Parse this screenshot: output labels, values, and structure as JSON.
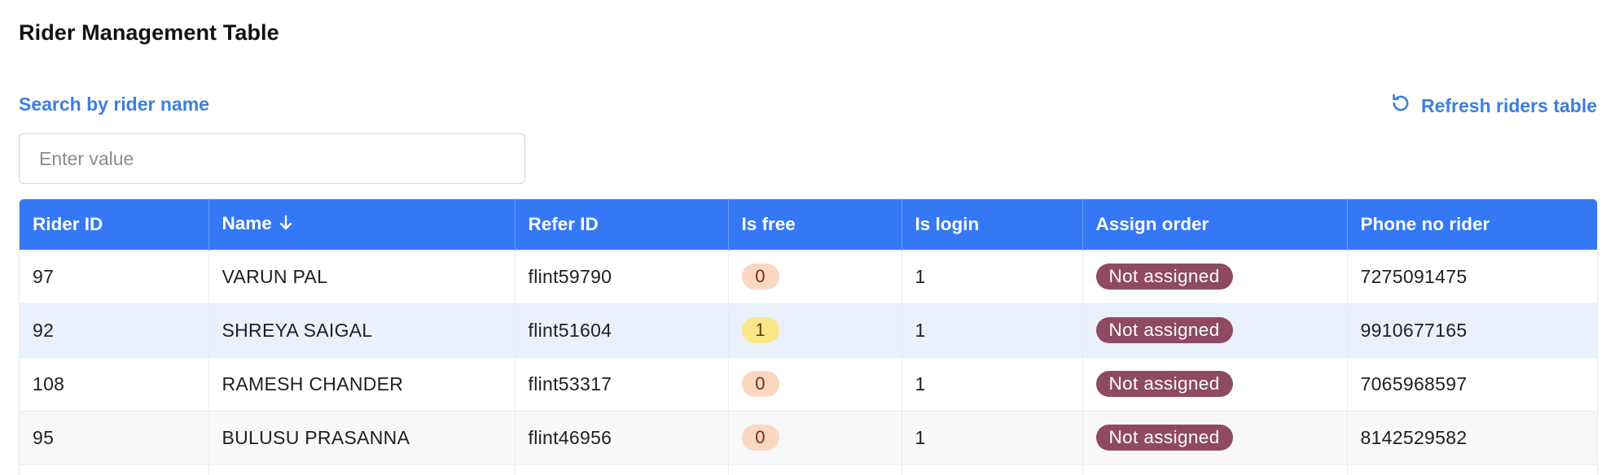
{
  "page": {
    "title": "Rider Management Table"
  },
  "search": {
    "label": "Search by rider name",
    "placeholder": "Enter value",
    "value": ""
  },
  "refresh": {
    "label": "Refresh riders table",
    "icon": "refresh-icon"
  },
  "table": {
    "headers": {
      "rider_id": "Rider ID",
      "name": "Name",
      "refer_id": "Refer ID",
      "is_free": "Is free",
      "is_login": "Is login",
      "assign_order": "Assign order",
      "phone": "Phone no rider"
    },
    "sort": {
      "column": "name",
      "direction": "descending",
      "icon": "arrow-down-icon"
    },
    "rows": [
      {
        "rider_id": "97",
        "name": "VARUN PAL",
        "refer_id": "flint59790",
        "is_free": "0",
        "is_login": "1",
        "assign_order": "Not assigned",
        "phone": "7275091475"
      },
      {
        "rider_id": "92",
        "name": "SHREYA SAIGAL",
        "refer_id": "flint51604",
        "is_free": "1",
        "is_login": "1",
        "assign_order": "Not assigned",
        "phone": "9910677165"
      },
      {
        "rider_id": "108",
        "name": "RAMESH CHANDER",
        "refer_id": "flint53317",
        "is_free": "0",
        "is_login": "1",
        "assign_order": "Not assigned",
        "phone": "7065968597"
      },
      {
        "rider_id": "95",
        "name": "BULUSU PRASANNA",
        "refer_id": "flint46956",
        "is_free": "0",
        "is_login": "1",
        "assign_order": "Not assigned",
        "phone": "8142529582"
      }
    ]
  },
  "colors": {
    "accent": "#3b7fe0",
    "header_bg": "#3478f6",
    "assign_badge": "#8f4a62",
    "free_zero": "#fbd7c2",
    "free_one": "#fbe68a",
    "selected_row": "#eaf1fc"
  }
}
